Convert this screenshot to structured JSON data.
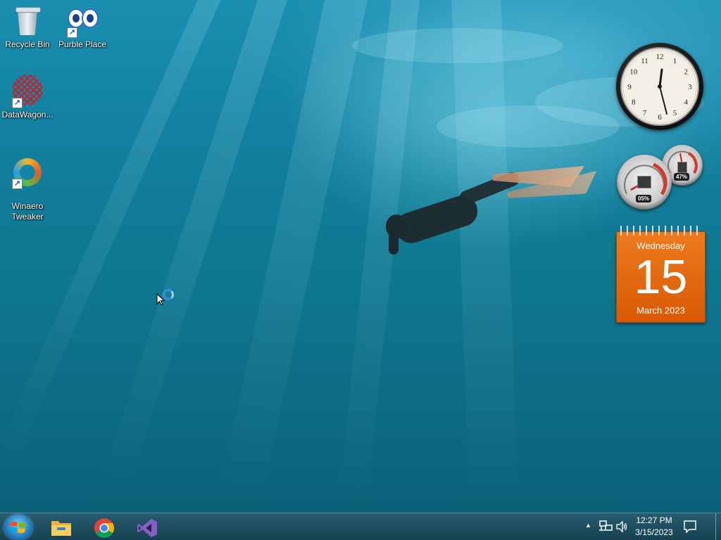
{
  "desktop_icons": [
    {
      "label": "Recycle Bin",
      "icon": "recycle-bin-icon",
      "shortcut": false
    },
    {
      "label": "Purble Place",
      "icon": "purble-place-icon",
      "shortcut": true
    },
    {
      "label": "DataWagon...",
      "icon": "datawagon-icon",
      "shortcut": true
    },
    {
      "label": "Winaero\nTweaker",
      "icon": "winaero-tweaker-icon",
      "shortcut": true
    }
  ],
  "gadgets": {
    "clock": {
      "numerals": [
        "12",
        "1",
        "2",
        "3",
        "4",
        "5",
        "6",
        "7",
        "8",
        "9",
        "10",
        "11"
      ]
    },
    "cpu_meter": {
      "cpu_label": "05%",
      "memory_label": "47%"
    },
    "calendar": {
      "weekday": "Wednesday",
      "day": "15",
      "month_year": "March 2023",
      "color": "#e8700f"
    }
  },
  "taskbar": {
    "pinned": [
      "file-explorer-icon",
      "chrome-icon",
      "visual-studio-icon"
    ],
    "tray": {
      "overflow_glyph": "▲",
      "time": "12:27 PM",
      "date": "3/15/2023"
    }
  }
}
